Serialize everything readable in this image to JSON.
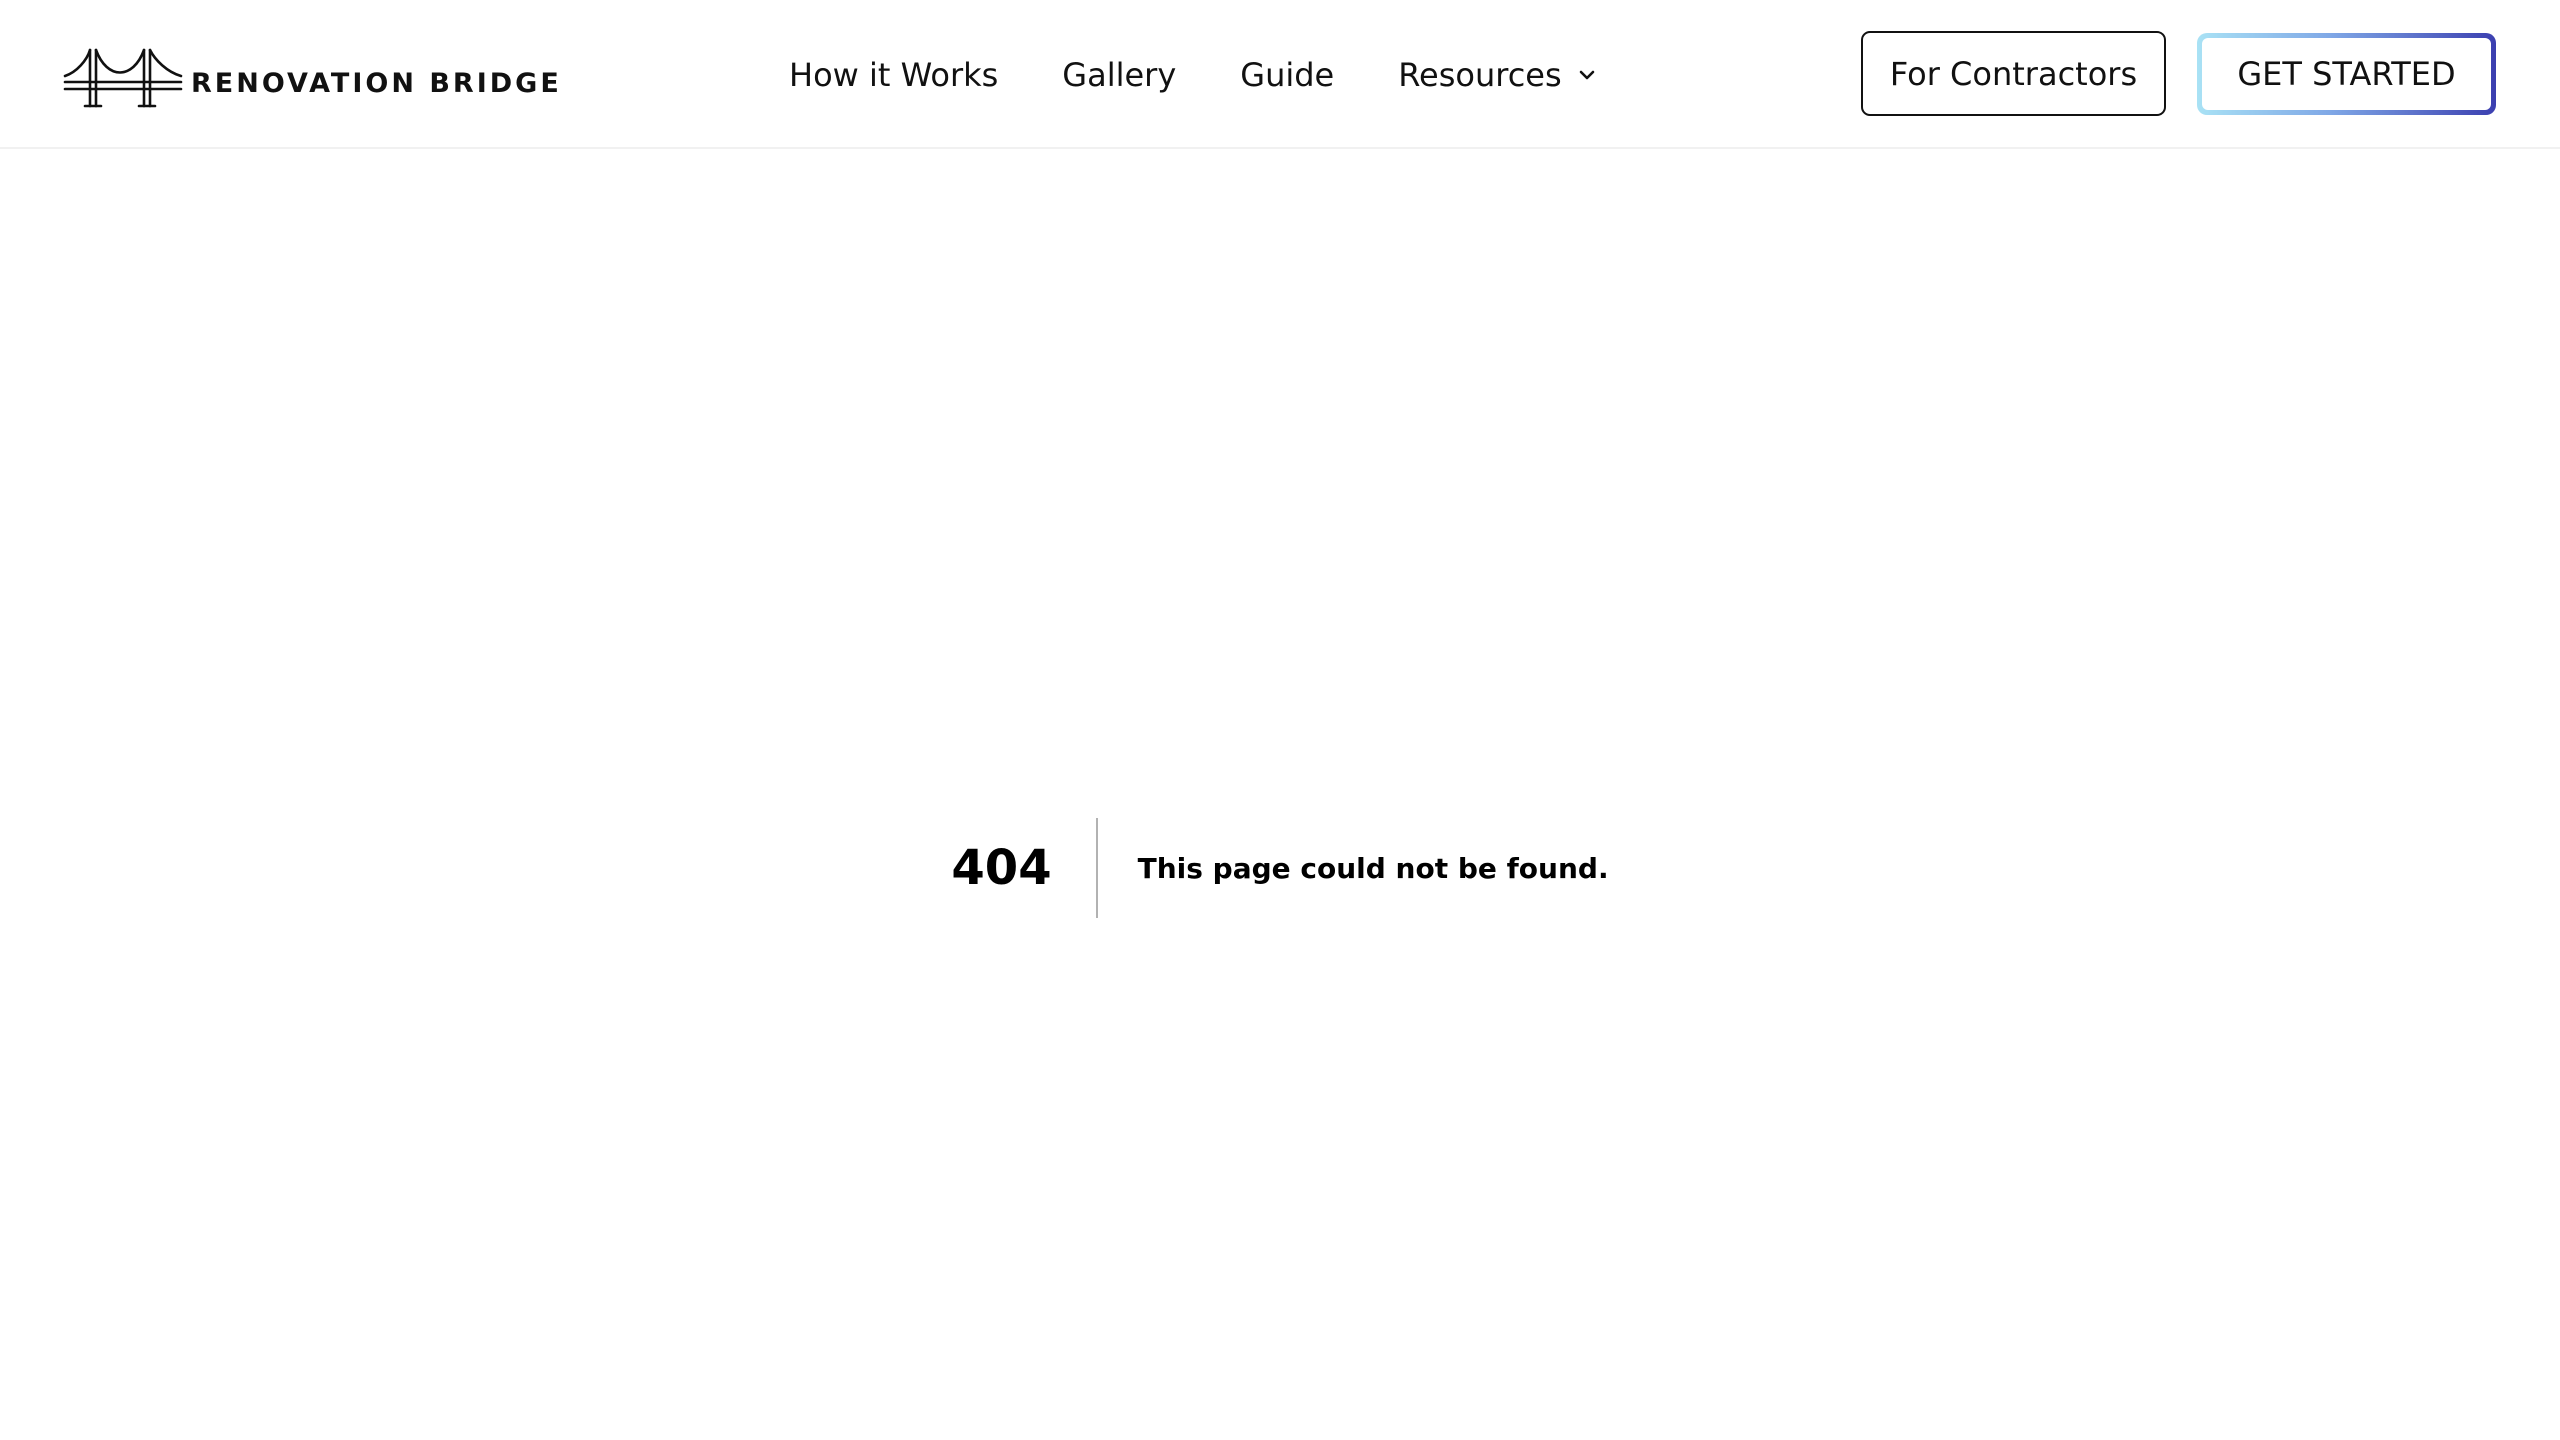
{
  "header": {
    "logo": {
      "icon": "bridge-icon",
      "text": "RENOVATION BRIDGE"
    },
    "nav": [
      {
        "label": "How it Works"
      },
      {
        "label": "Gallery"
      },
      {
        "label": "Guide"
      },
      {
        "label": "Resources",
        "icon": "chevron-down-icon"
      }
    ],
    "contractors_button": "For Contractors",
    "get_started_button": "GET STARTED"
  },
  "error": {
    "code": "404",
    "message": "This page could not be found."
  },
  "colors": {
    "text": "#111111",
    "gradient_start": "#a9e2f5",
    "gradient_mid": "#7fa7e6",
    "gradient_end": "#3b3fb0",
    "background": "#ffffff"
  }
}
